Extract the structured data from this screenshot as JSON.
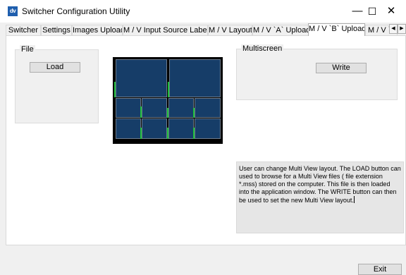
{
  "window": {
    "icon_text": "dv",
    "title": "Switcher Configuration Utility",
    "minimize_glyph": "—",
    "maximize_glyph": "☐",
    "close_glyph": "✕"
  },
  "tabs": [
    {
      "label": "Switcher"
    },
    {
      "label": "Settings"
    },
    {
      "label": "Images Upload"
    },
    {
      "label": "M / V  Input Source Labels"
    },
    {
      "label": "M / V Layout"
    },
    {
      "label": "M / V `A` Upload"
    },
    {
      "label": "M / V `B` Upload",
      "active": true
    },
    {
      "label": "M / V `"
    }
  ],
  "tab_scroll": {
    "left": "◀",
    "right": "▶"
  },
  "file_group": {
    "label": "File",
    "load_button": "Load"
  },
  "multiscreen_group": {
    "label": "Multiscreen",
    "write_button": "Write"
  },
  "preview": {
    "layout": "2 large tiles over 2 rows of 4 small tiles",
    "tile_color": "#163d68",
    "tally_color": "#1fbf3c"
  },
  "description": "User can change Multi View  layout. The LOAD button can used to browse for a Multi View  files ( file extension *.mss) stored on the computer. This file is then loaded into the application window. The WRITE button can then be used to set the new Multi View  layout.",
  "exit_button": "Exit"
}
